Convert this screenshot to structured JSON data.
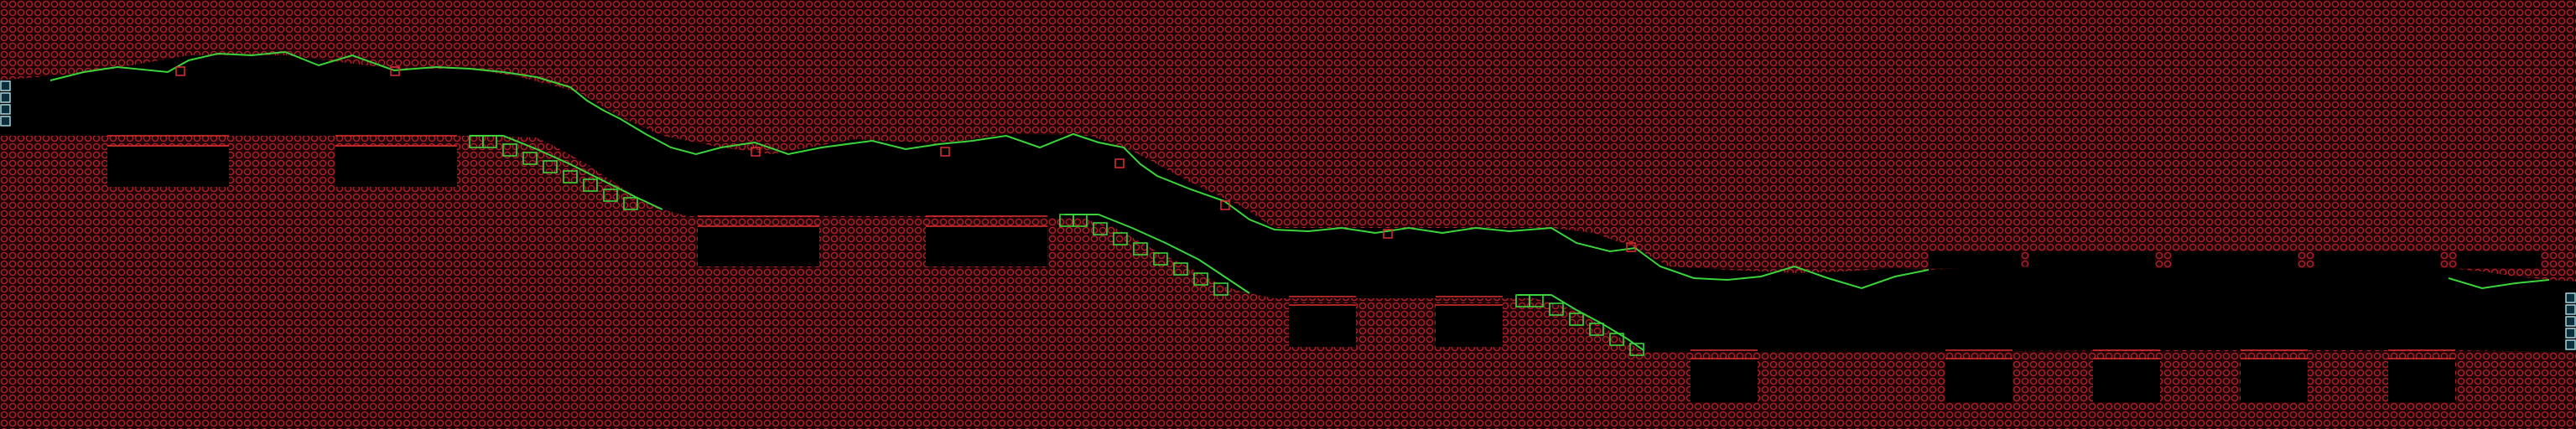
{
  "screen": {
    "title": "",
    "description_label": ""
  },
  "palette": {
    "background": "#000000",
    "solid_fill": "#1e0406",
    "solid_ring": "#b0202a",
    "slope_outline": "#3ad43a",
    "slope_fill": "#0a2a0a",
    "marker_stroke": "#a7d3dc",
    "marker_fill": "#0c2e3a",
    "red_small": "#e03030"
  },
  "tile_legend": {
    "solid": "red-ring-tile",
    "slope": "green-slope-tile",
    "marker": "cyan-box-marker",
    "bracket": "red-bracket-tile"
  }
}
